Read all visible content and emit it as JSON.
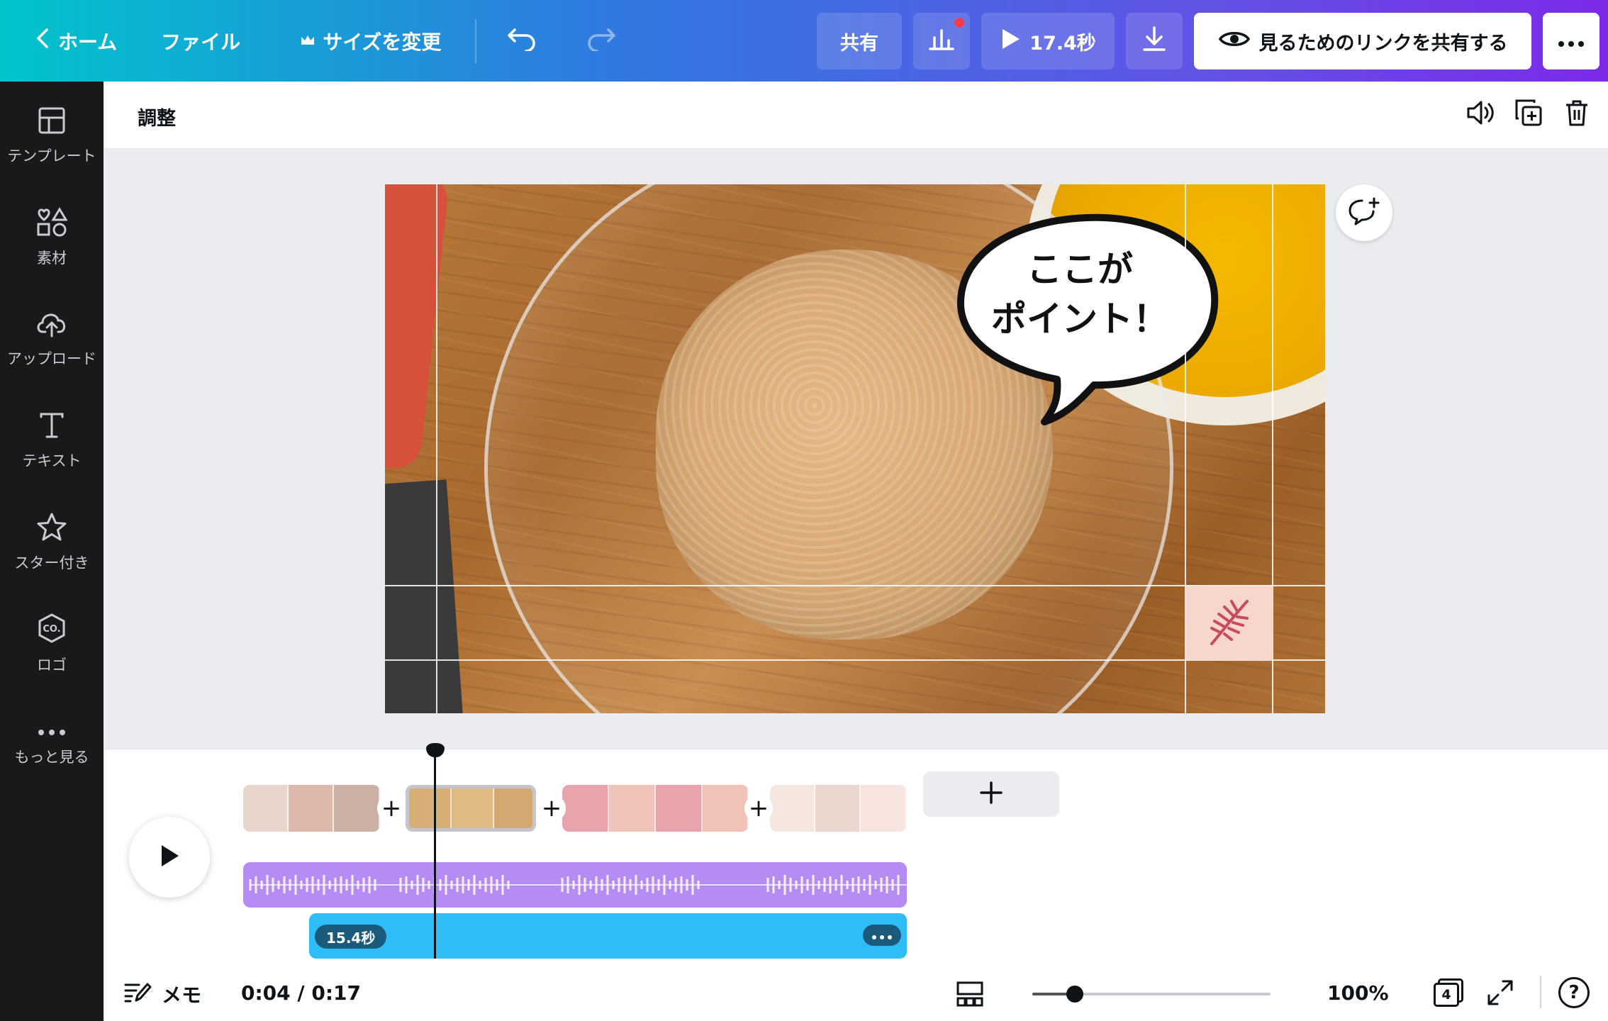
{
  "topbar": {
    "home": "ホーム",
    "file": "ファイル",
    "resize": "サイズを変更",
    "share": "共有",
    "duration": "17.4秒",
    "view_link": "見るためのリンクを共有する"
  },
  "sidebar": {
    "items": [
      {
        "label": "テンプレート",
        "icon": "template-icon"
      },
      {
        "label": "素材",
        "icon": "elements-icon"
      },
      {
        "label": "アップロード",
        "icon": "upload-icon"
      },
      {
        "label": "テキスト",
        "icon": "text-icon"
      },
      {
        "label": "スター付き",
        "icon": "star-icon"
      },
      {
        "label": "ロゴ",
        "icon": "logo-icon"
      },
      {
        "label": "もっと見る",
        "icon": "more-icon"
      }
    ]
  },
  "context": {
    "title": "調整"
  },
  "canvas": {
    "bubble_text": "ここが\nポイント！"
  },
  "timeline": {
    "bgm_label": "15.4秒"
  },
  "status": {
    "notes": "メモ",
    "time": "0:04 / 0:17",
    "zoom": "100%",
    "pages": "4",
    "help": "?"
  },
  "colors": {
    "accent_gradient_start": "#00c4cc",
    "accent_gradient_end": "#7d2ae8",
    "audio_track": "#b48cf3",
    "music_track": "#2ebdf7"
  }
}
